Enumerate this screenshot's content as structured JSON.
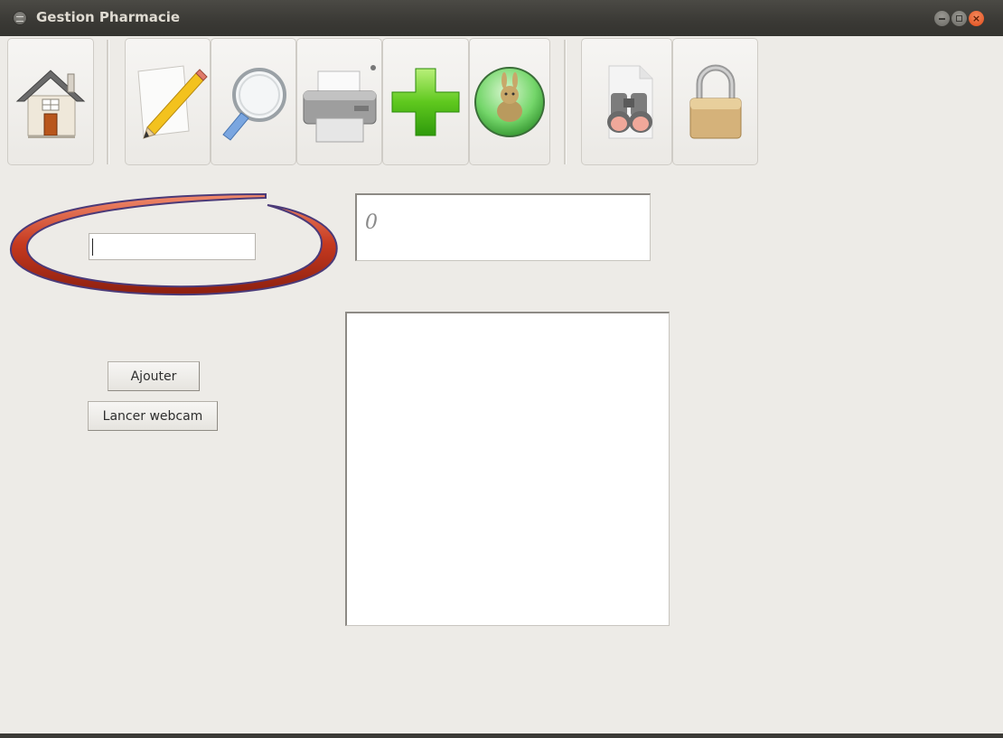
{
  "window": {
    "title": "Gestion Pharmacie"
  },
  "toolbar": {
    "buttons": [
      {
        "icon": "house-icon"
      },
      {
        "icon": "pencil-icon"
      },
      {
        "icon": "magnifier-icon"
      },
      {
        "icon": "printer-icon"
      },
      {
        "icon": "plus-icon"
      },
      {
        "icon": "rabbit-globe-icon"
      },
      {
        "icon": "binoculars-icon"
      },
      {
        "icon": "padlock-icon"
      }
    ]
  },
  "form": {
    "code_input_value": "",
    "display_value": "0",
    "add_label": "Ajouter",
    "webcam_label": "Lancer webcam"
  },
  "colors": {
    "titlebar": "#3c3b37",
    "window_bg": "#edebe7",
    "close_button": "#e5581f",
    "ellipse_red": "#b8321c",
    "ellipse_purple": "#4b3a78"
  }
}
